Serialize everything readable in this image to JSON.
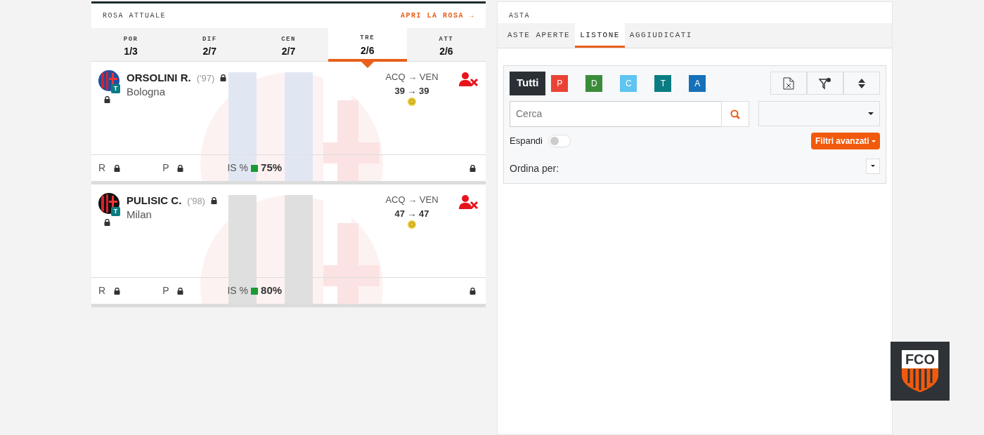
{
  "rosa": {
    "title": "ROSA ATTUALE",
    "link": "APRI LA ROSA →",
    "roles": [
      {
        "label": "POR",
        "count": "1/3",
        "selected": false
      },
      {
        "label": "DIF",
        "count": "2/7",
        "selected": false
      },
      {
        "label": "CEN",
        "count": "2/7",
        "selected": false
      },
      {
        "label": "TRE",
        "count": "2/6",
        "selected": true
      },
      {
        "label": "ATT",
        "count": "2/6",
        "selected": false
      }
    ],
    "players": [
      {
        "name": "ORSOLINI R.",
        "year": "('97)",
        "team": "Bologna",
        "badge": "T",
        "color": "#1f4fa0",
        "trade_label": "ACQ → VEN",
        "prices": "39 → 39",
        "stat_r": "R",
        "stat_p": "P",
        "is_label": "IS %",
        "is_value": "75%"
      },
      {
        "name": "PULISIC C.",
        "year": "('98)",
        "team": "Milan",
        "badge": "T",
        "color": "#111111",
        "trade_label": "ACQ → VEN",
        "prices": "47 → 47",
        "stat_r": "R",
        "stat_p": "P",
        "is_label": "IS %",
        "is_value": "80%"
      }
    ]
  },
  "asta": {
    "title": "ASTA",
    "tabs": [
      {
        "label": "ASTE APERTE",
        "selected": false
      },
      {
        "label": "LISTONE",
        "selected": true
      },
      {
        "label": "AGGIUDICATI",
        "selected": false
      }
    ],
    "filters": [
      {
        "label": "Tutti",
        "color": "#2b3036",
        "selected": true
      },
      {
        "label": "P",
        "color": "#ea4335",
        "selected": false
      },
      {
        "label": "D",
        "color": "#3b8c3a",
        "selected": false
      },
      {
        "label": "C",
        "color": "#5ec4f0",
        "selected": false
      },
      {
        "label": "T",
        "color": "#0b7d82",
        "selected": false
      },
      {
        "label": "A",
        "color": "#1671b8",
        "selected": false
      }
    ],
    "search": {
      "placeholder": "Cerca"
    },
    "toggle": {
      "label": "Espandi",
      "on": false
    },
    "advanced": "Filtri avanzati",
    "sort_label": "Ordina per:"
  },
  "logo": {
    "text": "FCO"
  }
}
